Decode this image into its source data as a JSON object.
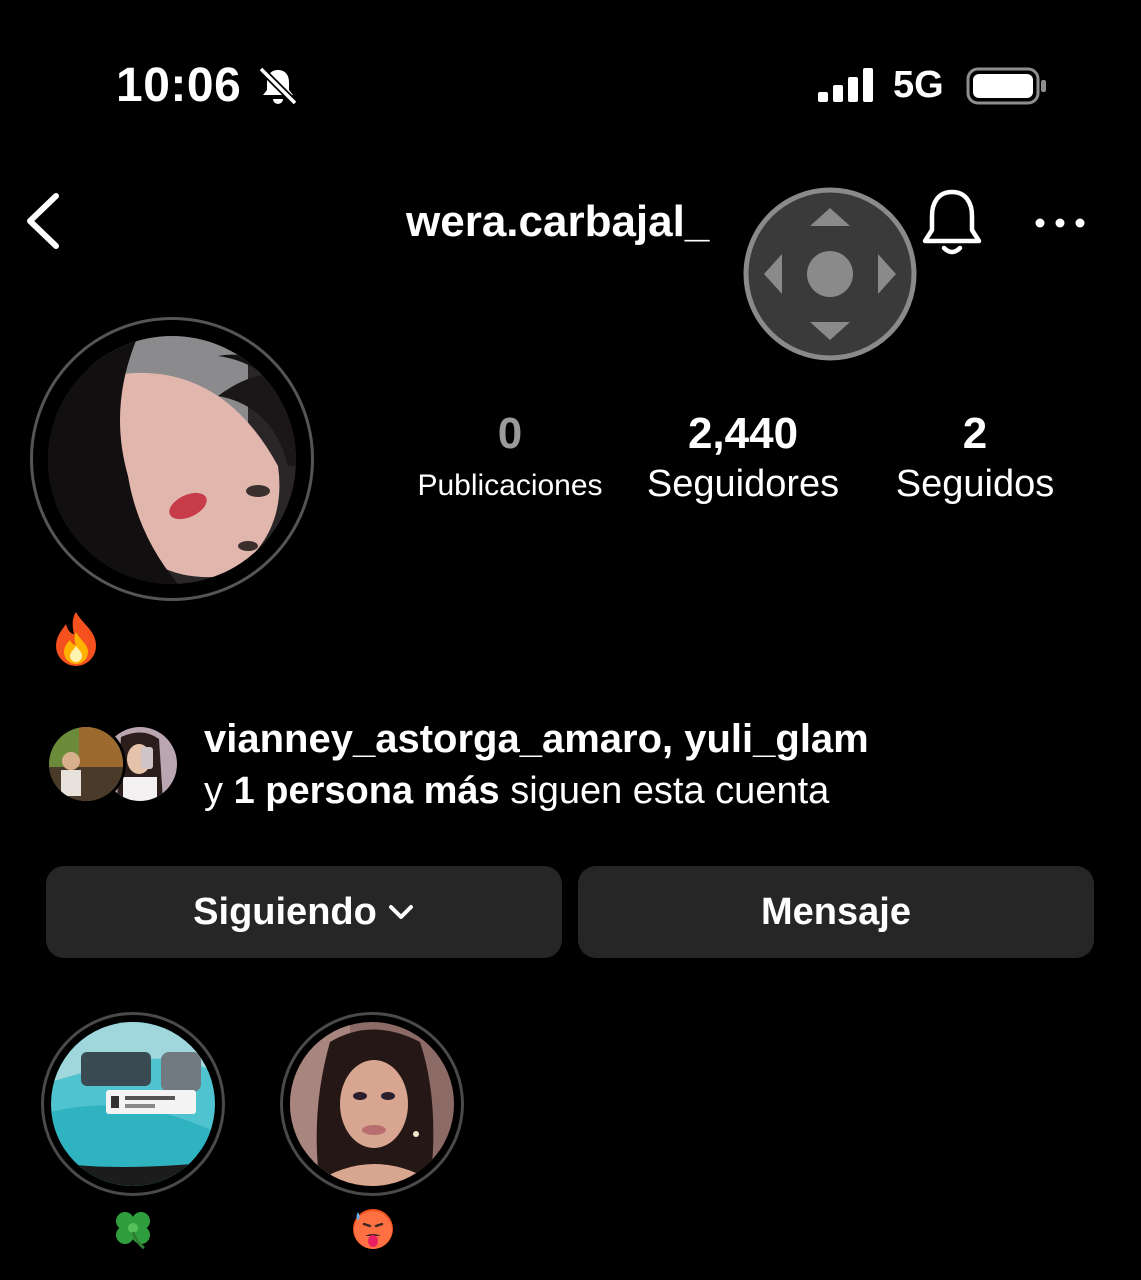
{
  "status_bar": {
    "time": "10:06",
    "network": "5G",
    "icons": [
      "mute-bell-icon",
      "signal-icon",
      "battery-icon"
    ]
  },
  "header": {
    "username": "wera.carbajal_",
    "icons": [
      "back-chevron-icon",
      "notification-bell-icon",
      "more-dots-icon",
      "joystick-overlay-icon"
    ]
  },
  "profile": {
    "bio_emoji_icon": "fire-emoji-icon",
    "stats": {
      "posts": {
        "value": "0",
        "label": "Publicaciones"
      },
      "followers": {
        "value": "2,440",
        "label": "Seguidores"
      },
      "following": {
        "value": "2",
        "label": "Seguidos"
      }
    }
  },
  "mutual": {
    "names": "vianney_astorga_amaro, yuli_glam",
    "prefix": "y",
    "more": "1 persona más",
    "suffix": "siguen esta cuenta"
  },
  "actions": {
    "following_label": "Siguiendo",
    "message_label": "Mensaje"
  },
  "highlights": [
    {
      "emoji_icon": "four-leaf-clover-emoji"
    },
    {
      "emoji_icon": "hot-face-emoji"
    }
  ],
  "colors": {
    "background": "#000000",
    "button_bg": "#262626",
    "muted_text": "#9a9a9a",
    "ring": "#555555"
  }
}
